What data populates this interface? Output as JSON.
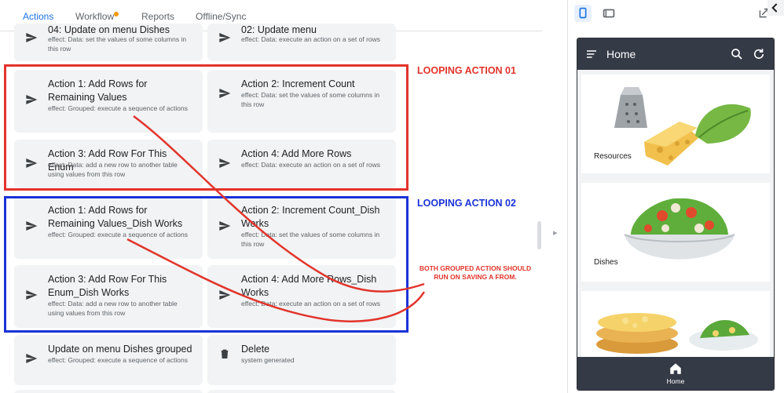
{
  "tabs": {
    "actions": "Actions",
    "workflow": "Workflow",
    "reports": "Reports",
    "offline_sync": "Offline/Sync"
  },
  "cards": [
    {
      "title": "04: Update on menu Dishes",
      "effect": "effect: Data: set the values of some columns in this row",
      "icon": "send-icon"
    },
    {
      "title": "02: Update menu",
      "effect": "effect: Data: execute an action on a set of rows",
      "icon": "send-icon"
    },
    {
      "title": "Action 1: Add Rows for Remaining Values",
      "effect": "effect: Grouped: execute a sequence of actions",
      "icon": "send-icon"
    },
    {
      "title": "Action 2: Increment Count",
      "effect": "effect: Data: set the values of some columns in this row",
      "icon": "send-icon"
    },
    {
      "title": "Action 3: Add Row For This Enum",
      "effect": "effect: Data: add a new row to another table using values from this row",
      "icon": "send-icon"
    },
    {
      "title": "Action 4: Add More Rows",
      "effect": "effect: Data: execute an action on a set of rows",
      "icon": "send-icon"
    },
    {
      "title": "Action 1: Add Rows for Remaining Values_Dish Works",
      "effect": "effect: Grouped: execute a sequence of actions",
      "icon": "send-icon"
    },
    {
      "title": "Action 2: Increment Count_Dish Works",
      "effect": "effect: Data: set the values of some columns in this row",
      "icon": "send-icon"
    },
    {
      "title": "Action 3: Add Row For This Enum_Dish Works",
      "effect": "effect: Data: add a new row to another table using values from this row",
      "icon": "send-icon"
    },
    {
      "title": "Action 4: Add More Rows_Dish Works",
      "effect": "effect: Data: execute an action on a set of rows",
      "icon": "send-icon"
    },
    {
      "title": "Update on menu Dishes grouped",
      "effect": "effect: Grouped: execute a sequence of actions",
      "icon": "send-icon"
    },
    {
      "title": "Delete",
      "effect": "system generated",
      "icon": "trash-icon"
    }
  ],
  "annotations": {
    "looping_1": "LOOPING ACTION 01",
    "looping_2": "LOOPING ACTION 02",
    "note": "BOTH GROUPED ACTION SHOULD RUN ON SAVING A FROM."
  },
  "preview": {
    "app_title": "Home",
    "cards": [
      {
        "label": "Resources"
      },
      {
        "label": "Dishes"
      },
      {
        "label": ""
      }
    ],
    "bottom_nav_label": "Home"
  },
  "colors": {
    "accent": "#1a73e8",
    "annotation_red": "#e2342b",
    "annotation_blue": "#1a33d6",
    "app_bar": "#343a46",
    "card_bg": "#f1f3f4"
  }
}
